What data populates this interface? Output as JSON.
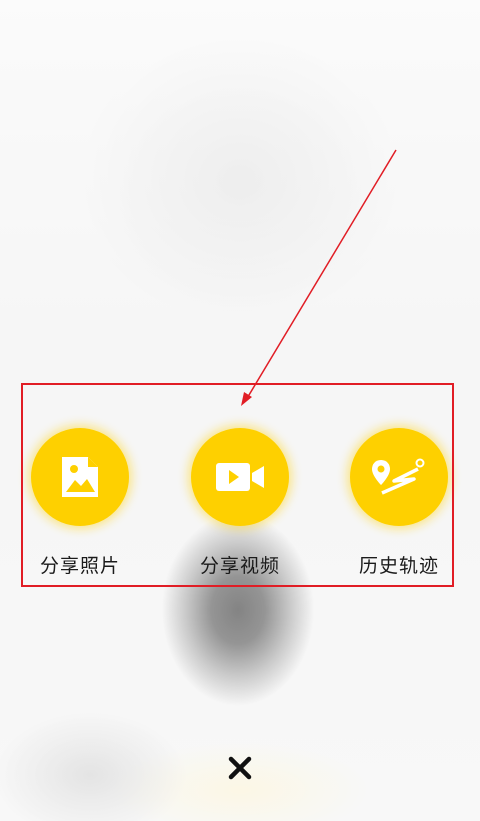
{
  "theme": {
    "accent": "#fed000",
    "annotation": "#e11d25",
    "text": "#1b1b1b"
  },
  "actions": [
    {
      "label": "分享照片",
      "icon": "photo-file-icon"
    },
    {
      "label": "分享视频",
      "icon": "video-camera-icon"
    },
    {
      "label": "历史轨迹",
      "icon": "route-map-icon"
    }
  ],
  "close": {
    "icon": "close-icon"
  }
}
